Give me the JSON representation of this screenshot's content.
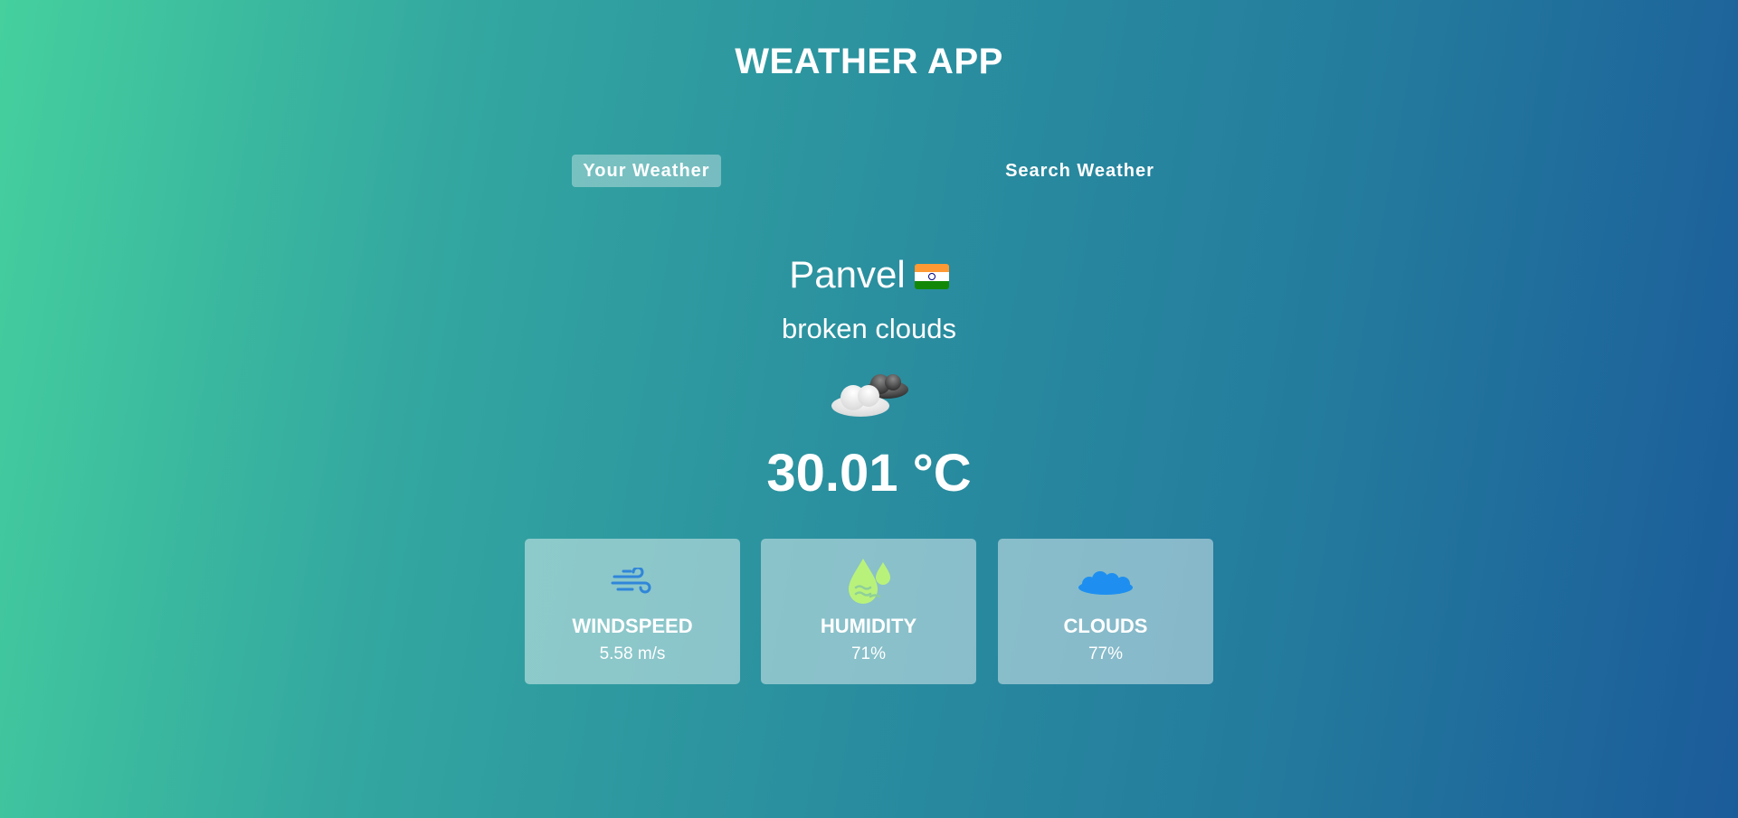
{
  "app": {
    "title": "WEATHER APP"
  },
  "tabs": [
    {
      "label": "Your Weather",
      "active": true
    },
    {
      "label": "Search Weather",
      "active": false
    }
  ],
  "location": {
    "city": "Panvel",
    "country_flag_icon": "flag-india-icon"
  },
  "weather": {
    "description": "broken clouds",
    "icon": "broken-clouds-icon",
    "temperature": "30.01 °C"
  },
  "stats": [
    {
      "label": "WINDSPEED",
      "value": "5.58 m/s",
      "icon": "wind-icon",
      "icon_color": "#2f86d9"
    },
    {
      "label": "HUMIDITY",
      "value": "71%",
      "icon": "humidity-drops-icon",
      "icon_color": "#b9f27a"
    },
    {
      "label": "CLOUDS",
      "value": "77%",
      "icon": "clouds-icon",
      "icon_color": "#1e8ff0"
    }
  ],
  "colors": {
    "gradient_start": "#45d09e",
    "gradient_end": "#1b5b9a",
    "active_tab_bg": "rgba(255,255,255,0.35)",
    "card_bg": "rgba(255,255,255,0.45)"
  }
}
